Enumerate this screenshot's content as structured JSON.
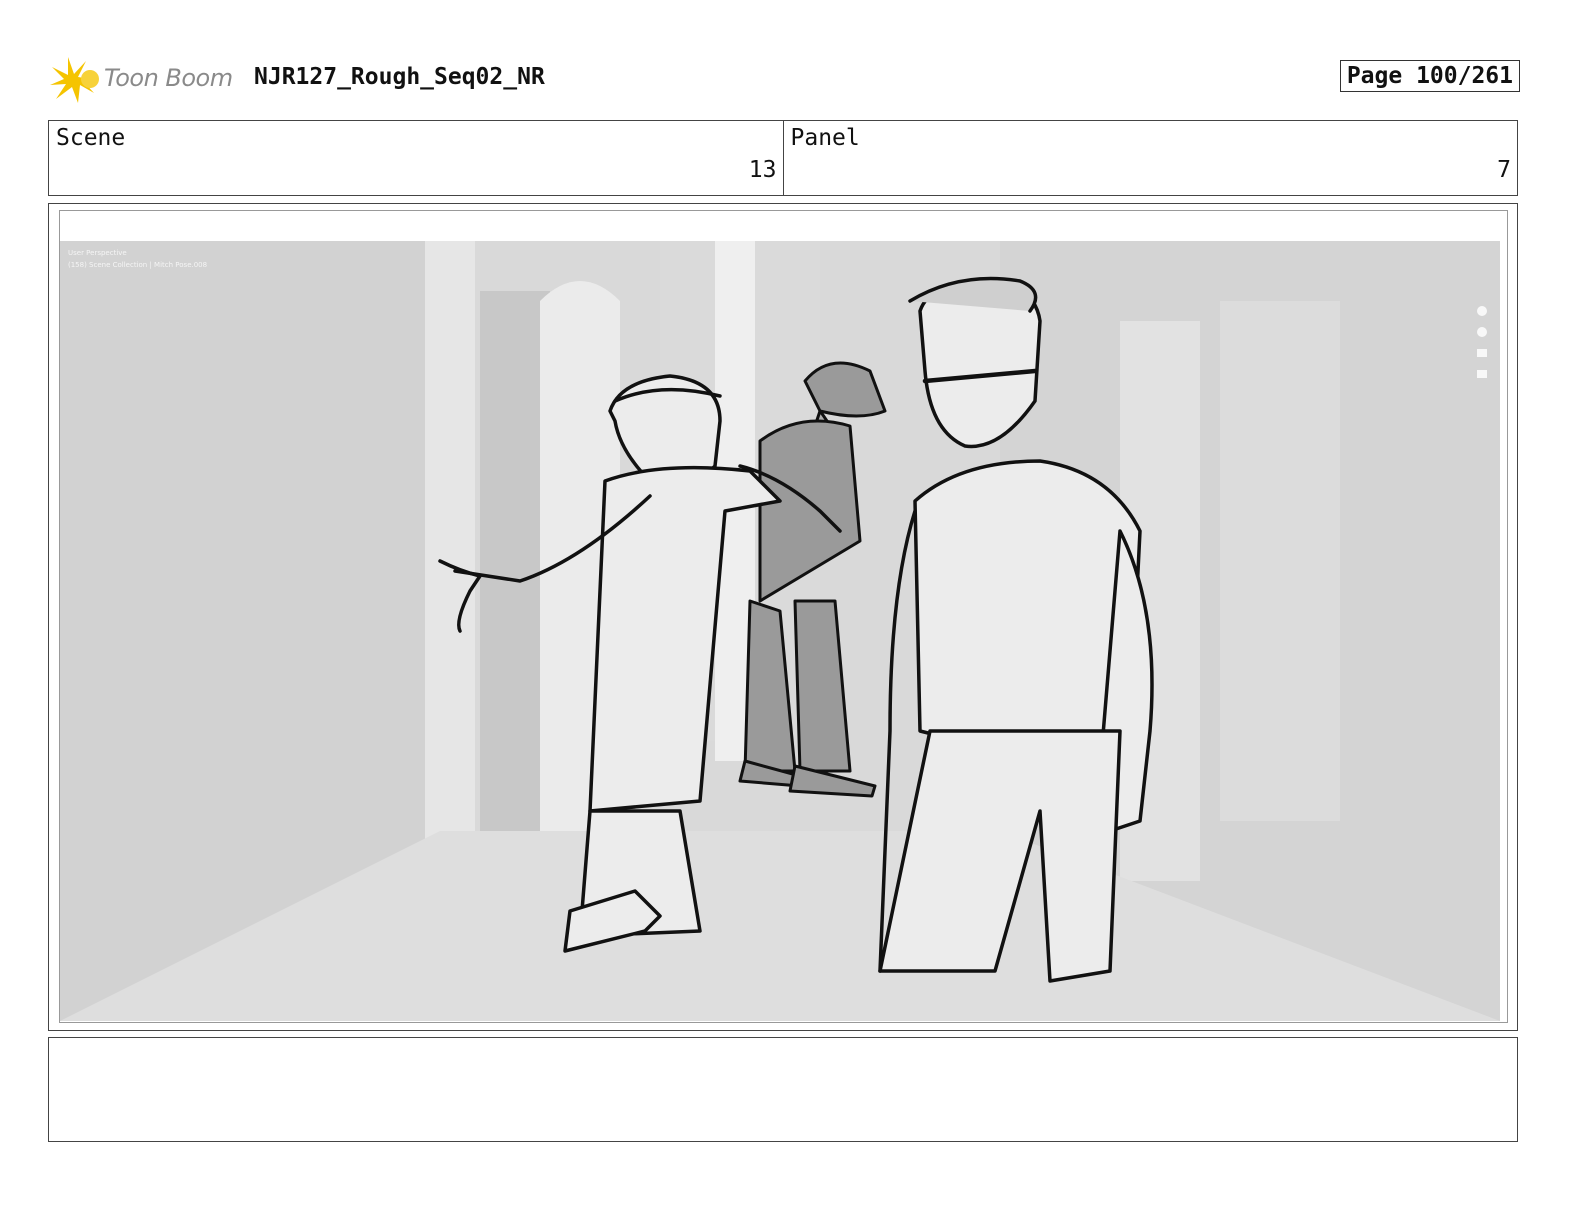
{
  "header": {
    "logo_text": "Toon Boom",
    "document_title": "NJR127_Rough_Seq02_NR",
    "page_label": "Page 100/261"
  },
  "scene": {
    "label": "Scene",
    "value": "13"
  },
  "panel": {
    "label": "Panel",
    "value": "7"
  },
  "panel_image": {
    "viewport_overlay_line1": "User Perspective",
    "viewport_overlay_line2": "(158) Scene Collection | Mitch Pose.008",
    "description_icons": [
      "zoom-icon",
      "hand-pan-icon",
      "camera-icon",
      "grid-icon"
    ]
  },
  "notes": {
    "text": ""
  },
  "colors": {
    "logo_accent": "#f5c400",
    "frame": "#444444"
  }
}
